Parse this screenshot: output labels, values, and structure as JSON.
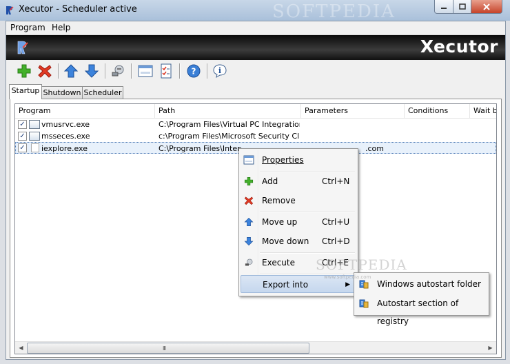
{
  "window": {
    "title": "Xecutor - Scheduler active",
    "watermark": "SOFTPEDIA"
  },
  "menu": [
    "Program",
    "Help"
  ],
  "banner": {
    "title": "Xecutor"
  },
  "toolbar": {
    "icons": [
      "add-icon",
      "remove-icon",
      "move-up-icon",
      "move-down-icon",
      "execute-icon",
      "window-icon",
      "checklist-icon",
      "help-icon",
      "info-icon"
    ]
  },
  "tabs": [
    "Startup",
    "Shutdown",
    "Scheduler"
  ],
  "list": {
    "columns": [
      "Program",
      "Path",
      "Parameters",
      "Conditions",
      "Wait b"
    ],
    "rows": [
      {
        "checked": true,
        "program": "vmusrvc.exe",
        "path": "C:\\Program Files\\Virtual PC Integration ...",
        "parameters": ""
      },
      {
        "checked": true,
        "program": "msseces.exe",
        "path": "c:\\Program Files\\Microsoft Security Clie...",
        "parameters": ""
      },
      {
        "checked": true,
        "program": "iexplore.exe",
        "path": "C:\\Program Files\\Interne",
        "parameters": ".com"
      }
    ],
    "scroll_grip": "III"
  },
  "context_menu": {
    "items": [
      {
        "label": "Properties",
        "shortcut": ""
      },
      {
        "label": "Add",
        "shortcut": "Ctrl+N"
      },
      {
        "label": "Remove",
        "shortcut": ""
      },
      {
        "label": "Move up",
        "shortcut": "Ctrl+U"
      },
      {
        "label": "Move down",
        "shortcut": "Ctrl+D"
      },
      {
        "label": "Execute",
        "shortcut": "Ctrl+E"
      },
      {
        "label": "Export into",
        "shortcut": ""
      }
    ]
  },
  "submenu": {
    "items": [
      {
        "label": "Windows autostart folder"
      },
      {
        "label": "Autostart section of registry"
      }
    ]
  },
  "softpedia_mark": {
    "big": "SOFTPEDIA",
    "small": "www.softpedia.com"
  }
}
